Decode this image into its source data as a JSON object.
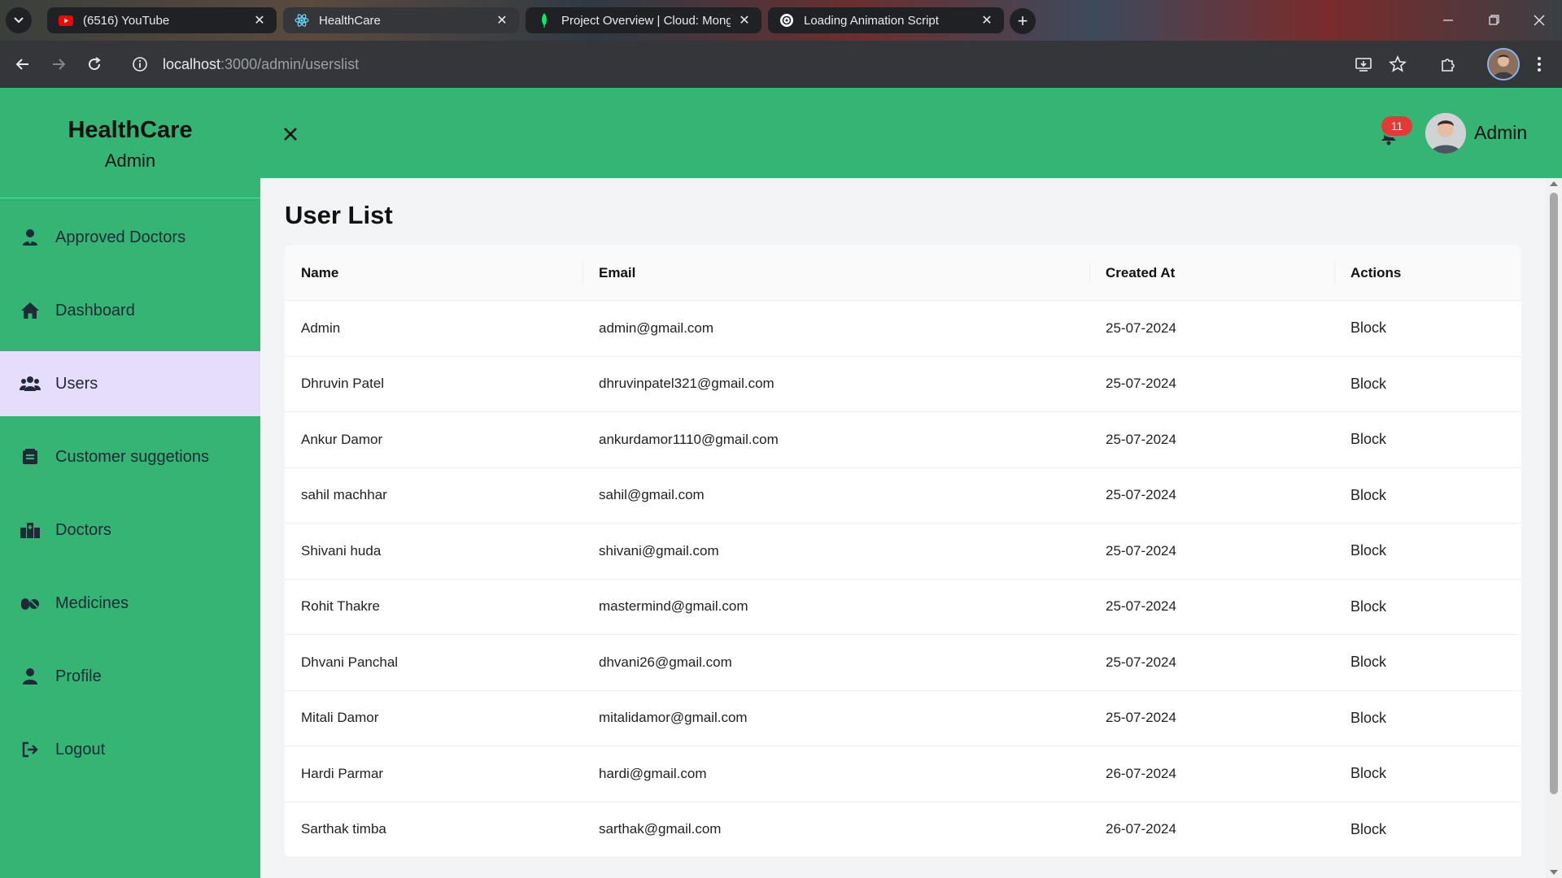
{
  "browser": {
    "tabs": [
      {
        "title": "(6516) YouTube",
        "favicon": "youtube-icon",
        "color": "#ff0000"
      },
      {
        "title": "HealthCare",
        "favicon": "react-icon",
        "color": "#61dafb",
        "active": true
      },
      {
        "title": "Project Overview | Cloud: MongoDB Cloud",
        "favicon": "mongodb-leaf-icon",
        "color": "#00ed64"
      },
      {
        "title": "Loading Animation Script",
        "favicon": "chatgpt-icon",
        "color": "#ffffff"
      }
    ],
    "url_host": "localhost",
    "url_path": ":3000/admin/userslist"
  },
  "sidebar": {
    "brand_title": "HealthCare",
    "brand_subtitle": "Admin",
    "items": [
      {
        "label": "Approved Doctors",
        "icon": "doctor-icon"
      },
      {
        "label": "Dashboard",
        "icon": "home-icon"
      },
      {
        "label": "Users",
        "icon": "users-icon",
        "active": true
      },
      {
        "label": "Customer suggetions",
        "icon": "suggestions-icon"
      },
      {
        "label": "Doctors",
        "icon": "hospital-icon"
      },
      {
        "label": "Medicines",
        "icon": "pills-icon"
      },
      {
        "label": "Profile",
        "icon": "user-icon"
      },
      {
        "label": "Logout",
        "icon": "logout-icon"
      }
    ]
  },
  "header": {
    "notification_count": "11",
    "user_name": "Admin"
  },
  "main": {
    "title": "User List",
    "columns": [
      "Name",
      "Email",
      "Created At",
      "Actions"
    ],
    "rows": [
      {
        "name": "Admin",
        "email": "admin@gmail.com",
        "created": "25-07-2024",
        "action": "Block"
      },
      {
        "name": "Dhruvin Patel",
        "email": "dhruvinpatel321@gmail.com",
        "created": "25-07-2024",
        "action": "Block"
      },
      {
        "name": "Ankur Damor",
        "email": "ankurdamor1110@gmail.com",
        "created": "25-07-2024",
        "action": "Block"
      },
      {
        "name": "sahil machhar",
        "email": "sahil@gmail.com",
        "created": "25-07-2024",
        "action": "Block"
      },
      {
        "name": "Shivani huda",
        "email": "shivani@gmail.com",
        "created": "25-07-2024",
        "action": "Block"
      },
      {
        "name": "Rohit Thakre",
        "email": "mastermind@gmail.com",
        "created": "25-07-2024",
        "action": "Block"
      },
      {
        "name": "Dhvani Panchal",
        "email": "dhvani26@gmail.com",
        "created": "25-07-2024",
        "action": "Block"
      },
      {
        "name": "Mitali Damor",
        "email": "mitalidamor@gmail.com",
        "created": "25-07-2024",
        "action": "Block"
      },
      {
        "name": "Hardi Parmar",
        "email": "hardi@gmail.com",
        "created": "26-07-2024",
        "action": "Block"
      },
      {
        "name": "Sarthak timba",
        "email": "sarthak@gmail.com",
        "created": "26-07-2024",
        "action": "Block"
      }
    ]
  },
  "colors": {
    "primary_green": "#34b574",
    "active_item": "#e6dcfb",
    "badge_red": "#e53935"
  }
}
